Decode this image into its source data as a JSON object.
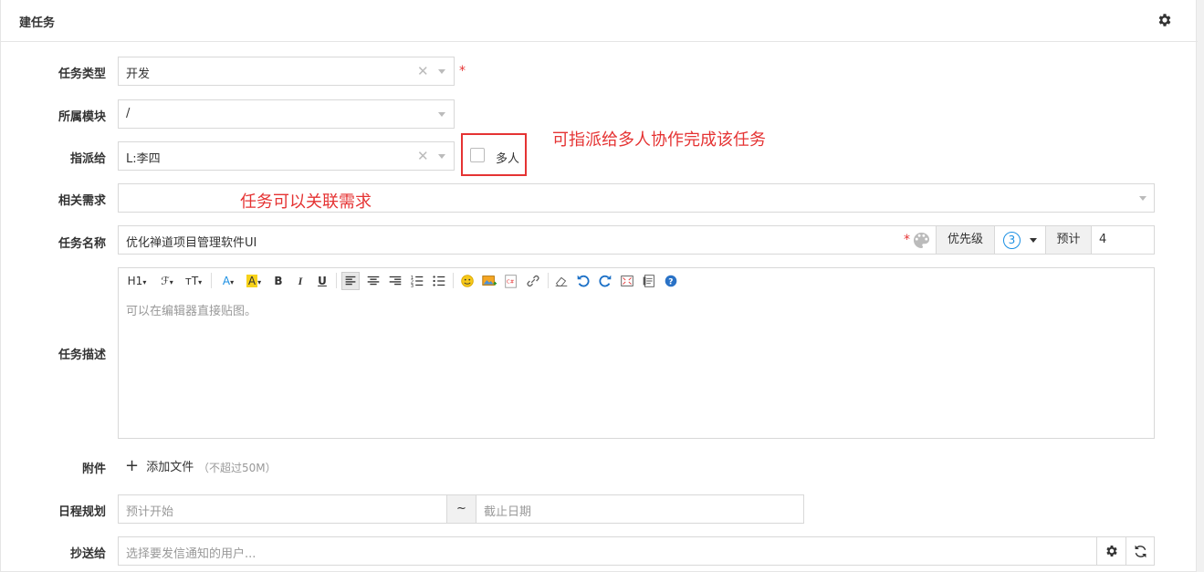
{
  "header": {
    "title": "建任务",
    "settings_icon": "gear-icon"
  },
  "form": {
    "type": {
      "label": "任务类型",
      "value": "开发",
      "required_mark": "*"
    },
    "module": {
      "label": "所属模块",
      "value": "/"
    },
    "assign": {
      "label": "指派给",
      "value": "L:李四",
      "multi_label": "多人",
      "multi_checked": false
    },
    "story": {
      "label": "相关需求",
      "value": ""
    },
    "name": {
      "label": "任务名称",
      "value": "优化禅道项目管理软件UI",
      "required_mark": "*",
      "priority_label": "优先级",
      "priority_value": "3",
      "estimate_label": "预计",
      "estimate_value": "4"
    },
    "desc": {
      "label": "任务描述",
      "placeholder": "可以在编辑器直接贴图。",
      "toolbar": {
        "h1": "H1",
        "font": "ℱ",
        "size": "тT",
        "fore": "A",
        "back": "A",
        "bold": "B",
        "italic": "I",
        "underline": "U"
      }
    },
    "files": {
      "label": "附件",
      "add_label": "添加文件",
      "hint": "（不超过50M）"
    },
    "schedule": {
      "label": "日程规划",
      "start_placeholder": "预计开始",
      "sep": "~",
      "end_placeholder": "截止日期"
    },
    "mailto": {
      "label": "抄送给",
      "placeholder": "选择要发信通知的用户..."
    }
  },
  "annotations": {
    "multi_assign": "可指派给多人协作完成该任务",
    "story_link": "任务可以关联需求"
  },
  "colors": {
    "accent": "#1a8fe3",
    "annotation": "#e53333",
    "required": "#e53333"
  }
}
